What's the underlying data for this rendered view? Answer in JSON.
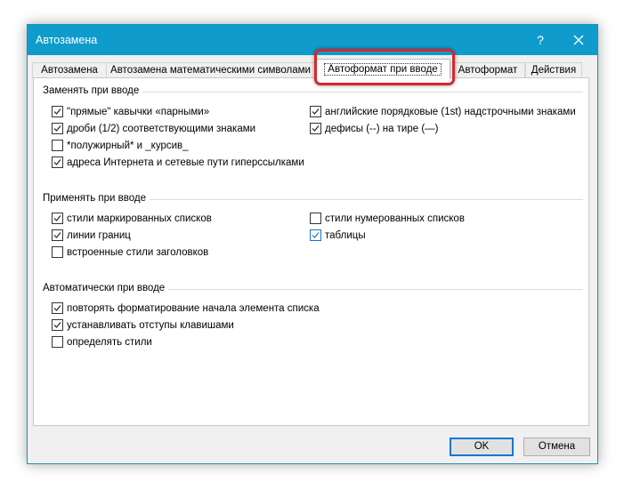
{
  "window": {
    "title": "Автозамена",
    "help_label": "?"
  },
  "tabs": [
    {
      "label": "Автозамена"
    },
    {
      "label": "Автозамена математическими символами"
    },
    {
      "label": "Автоформат при вводе"
    },
    {
      "label": "Автоформат"
    },
    {
      "label": "Действия"
    }
  ],
  "groups": {
    "replace": {
      "title": "Заменять при вводе",
      "left": [
        {
          "label": "\"прямые\" кавычки «парными»",
          "checked": true
        },
        {
          "label": "дроби (1/2) соответствующими знаками",
          "checked": true
        },
        {
          "label": "*полужирный* и _курсив_",
          "checked": false
        },
        {
          "label": "адреса Интернета и сетевые пути гиперссылками",
          "checked": true
        }
      ],
      "right": [
        {
          "label": "английские порядковые (1st) надстрочными знаками",
          "checked": true
        },
        {
          "label": "дефисы (--) на тире (—)",
          "checked": true
        }
      ]
    },
    "apply": {
      "title": "Применять при вводе",
      "left": [
        {
          "label": "стили маркированных списков",
          "checked": true
        },
        {
          "label": "линии границ",
          "checked": true
        },
        {
          "label": "встроенные стили заголовков",
          "checked": false
        }
      ],
      "right": [
        {
          "label": "стили нумерованных списков",
          "checked": false
        },
        {
          "label": "таблицы",
          "checked": true
        }
      ]
    },
    "auto": {
      "title": "Автоматически при вводе",
      "left": [
        {
          "label": "повторять форматирование начала элемента списка",
          "checked": true
        },
        {
          "label": "устанавливать отступы клавишами",
          "checked": true
        },
        {
          "label": "определять стили",
          "checked": false
        }
      ]
    }
  },
  "buttons": {
    "ok": "OK",
    "cancel": "Отмена"
  },
  "colors": {
    "titlebar": "#0f9ccc",
    "highlight": "#d7262e",
    "focus": "#0a78d7"
  },
  "icons": {
    "close": "close-icon",
    "check": "checkmark-icon"
  }
}
